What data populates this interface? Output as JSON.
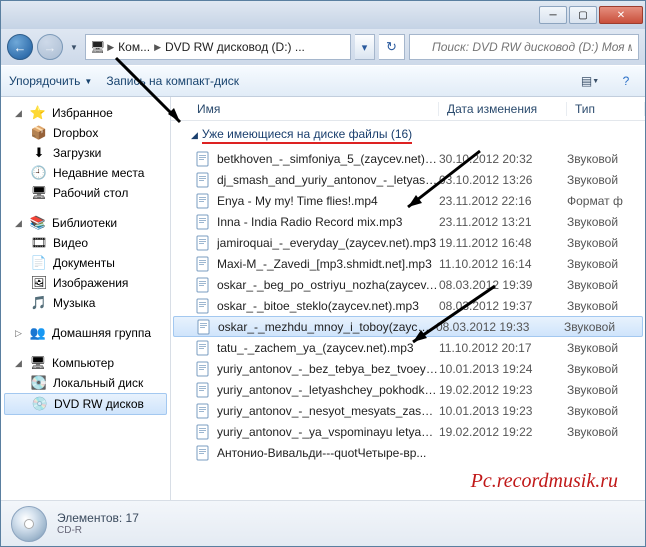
{
  "search_placeholder": "Поиск: DVD RW дисковод (D:) Моя м...",
  "breadcrumb": {
    "seg1": "Ком...",
    "seg2": "DVD RW дисковод (D:) ..."
  },
  "toolbar": {
    "organize": "Упорядочить",
    "burn": "Запись на компакт-диск"
  },
  "columns": {
    "name": "Имя",
    "date": "Дата изменения",
    "type": "Тип"
  },
  "sidebar": {
    "favorites": "Избранное",
    "favorites_items": [
      {
        "icon": "📦",
        "label": "Dropbox"
      },
      {
        "icon": "⬇",
        "label": "Загрузки"
      },
      {
        "icon": "🕘",
        "label": "Недавние места"
      },
      {
        "icon": "🖥",
        "label": "Рабочий стол"
      }
    ],
    "libraries": "Библиотеки",
    "libraries_items": [
      {
        "icon": "🎞",
        "label": "Видео"
      },
      {
        "icon": "📄",
        "label": "Документы"
      },
      {
        "icon": "🖼",
        "label": "Изображения"
      },
      {
        "icon": "🎵",
        "label": "Музыка"
      }
    ],
    "homegroup": "Домашняя группа",
    "computer": "Компьютер",
    "computer_items": [
      {
        "icon": "💽",
        "label": "Локальный диск"
      },
      {
        "icon": "💿",
        "label": "DVD RW дисков",
        "selected": true
      }
    ]
  },
  "group_header": "Уже имеющиеся на диске файлы (16)",
  "files": [
    {
      "name": "betkhoven_-_simfoniya_5_(zaycev.net).m...",
      "date": "30.10.2012 20:32",
      "type": "Звуковой"
    },
    {
      "name": "dj_smash_and_yuriy_antonov_-_letyashc...",
      "date": "03.10.2012 13:26",
      "type": "Звуковой"
    },
    {
      "name": "Enya - My my! Time flies!.mp4",
      "date": "23.11.2012 22:16",
      "type": "Формат ф"
    },
    {
      "name": "Inna - India Radio Record mix.mp3",
      "date": "23.11.2012 13:21",
      "type": "Звуковой"
    },
    {
      "name": "jamiroquai_-_everyday_(zaycev.net).mp3",
      "date": "19.11.2012 16:48",
      "type": "Звуковой"
    },
    {
      "name": "Maxi-M_-_Zavedi_[mp3.shmidt.net].mp3",
      "date": "11.10.2012 16:14",
      "type": "Звуковой"
    },
    {
      "name": "oskar_-_beg_po_ostriyu_nozha(zaycev.n...",
      "date": "08.03.2012 19:39",
      "type": "Звуковой"
    },
    {
      "name": "oskar_-_bitoe_steklo(zaycev.net).mp3",
      "date": "08.03.2012 19:37",
      "type": "Звуковой"
    },
    {
      "name": "oskar_-_mezhdu_mnoy_i_toboy(zaycev.n...",
      "date": "08.03.2012 19:33",
      "type": "Звуковой",
      "selected": true
    },
    {
      "name": "tatu_-_zachem_ya_(zaycev.net).mp3",
      "date": "11.10.2012 20:17",
      "type": "Звуковой"
    },
    {
      "name": "yuriy_antonov_-_bez_tebya_bez_tvoey_ly...",
      "date": "10.01.2013 19:24",
      "type": "Звуковой"
    },
    {
      "name": "yuriy_antonov_-_letyashchey_pokhodkoy...",
      "date": "19.02.2012 19:23",
      "type": "Звуковой"
    },
    {
      "name": "yuriy_antonov_-_nesyot_mesyats_zashel_...",
      "date": "10.01.2013 19:23",
      "type": "Звуковой"
    },
    {
      "name": "yuriy_antonov_-_ya_vspominayu letyash...",
      "date": "19.02.2012 19:22",
      "type": "Звуковой"
    },
    {
      "name": "Антонио-Вивальди---quotЧетыре-вр...",
      "date": "",
      "type": ""
    }
  ],
  "status": {
    "elements_label": "Элементов:",
    "elements_value": "17",
    "disc_label": "CD-R"
  },
  "watermark": "Pc.recordmusik.ru"
}
